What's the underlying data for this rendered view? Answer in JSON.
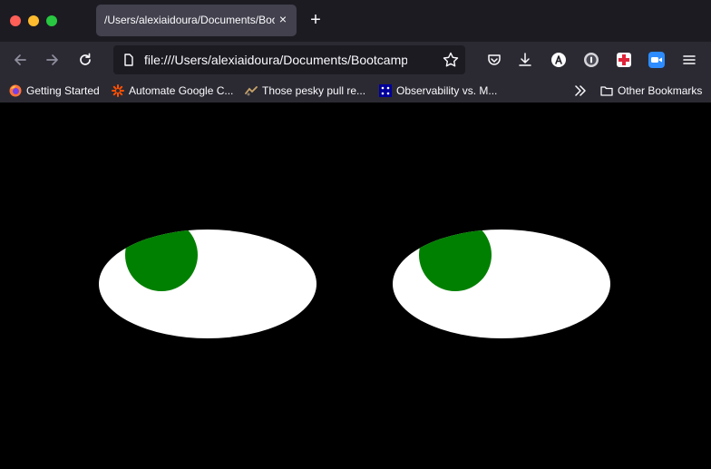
{
  "browser": {
    "tab": {
      "title": "/Users/alexiaidoura/Documents/Bootcamp/eyes",
      "close_glyph": "×"
    },
    "new_tab_glyph": "+",
    "url": "file:///Users/alexiaidoura/Documents/Bootcamp/eyes"
  },
  "bookmarks": [
    {
      "label": "Getting Started",
      "icon": "firefox-icon"
    },
    {
      "label": "Automate Google C...",
      "icon": "zapier-icon"
    },
    {
      "label": "Those pesky pull re...",
      "icon": "article-icon"
    },
    {
      "label": "Observability vs. M...",
      "icon": "sumo-logic-icon"
    }
  ],
  "other_bookmarks_label": "Other Bookmarks",
  "toolbar_icons": [
    "pocket-icon",
    "download-icon",
    "account-a-icon",
    "1password-icon",
    "extension-cross-icon",
    "zoom-icon",
    "menu-icon"
  ],
  "colors": {
    "page_background": "#000000",
    "eye_white": "#ffffff",
    "iris": "#008000"
  },
  "scene": {
    "eyes": [
      {
        "name": "left-eye"
      },
      {
        "name": "right-eye"
      }
    ]
  }
}
